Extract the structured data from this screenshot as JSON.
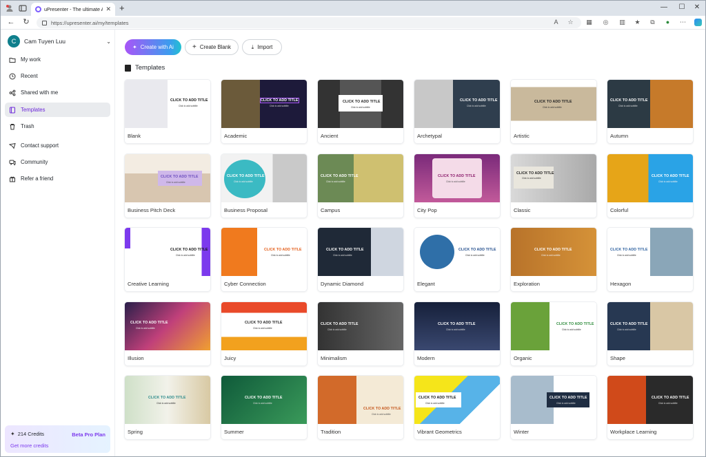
{
  "browser": {
    "tab_title": "uPresenter - The ultimate AI platf",
    "url": "https://upresenter.ai/my/templates"
  },
  "sidebar": {
    "user_initial": "C",
    "user_name": "Cam Tuyen Luu",
    "items": [
      {
        "label": "My work",
        "icon": "folder-icon"
      },
      {
        "label": "Recent",
        "icon": "clock-icon"
      },
      {
        "label": "Shared with me",
        "icon": "share-icon"
      },
      {
        "label": "Templates",
        "icon": "template-icon",
        "active": true
      },
      {
        "label": "Trash",
        "icon": "trash-icon"
      },
      {
        "label": "Contact support",
        "icon": "support-icon"
      },
      {
        "label": "Community",
        "icon": "community-icon"
      },
      {
        "label": "Refer a friend",
        "icon": "gift-icon"
      }
    ],
    "credits": {
      "amount": "214 Credits",
      "plan": "Beta Pro Plan",
      "more": "Get more credits"
    }
  },
  "toolbar": {
    "create_ai": "Create with Ai",
    "create_blank": "Create Blank",
    "import": "Import"
  },
  "section_title": "Templates",
  "thumb_text": {
    "title": "CLICK TO ADD TITLE",
    "subtitle": "Click to add subtitle"
  },
  "colors": {
    "accent": "#7c3aed",
    "avatar": "#0f7f8c",
    "active_bg": "#e9ebee"
  },
  "templates": [
    "Blank",
    "Academic",
    "Ancient",
    "Archetypal",
    "Artistic",
    "Autumn",
    "Business Pitch Deck",
    "Business Proposal",
    "Campus",
    "City Pop",
    "Classic",
    "Colorful",
    "Creative Learning",
    "Cyber Connection",
    "Dynamic Diamond",
    "Elegant",
    "Exploration",
    "Hexagon",
    "Illusion",
    "Juicy",
    "Minimalism",
    "Modern",
    "Organic",
    "Shape",
    "Spring",
    "Summer",
    "Tradition",
    "Vibrant Geometrics",
    "Winter",
    "Workplace Learning"
  ]
}
